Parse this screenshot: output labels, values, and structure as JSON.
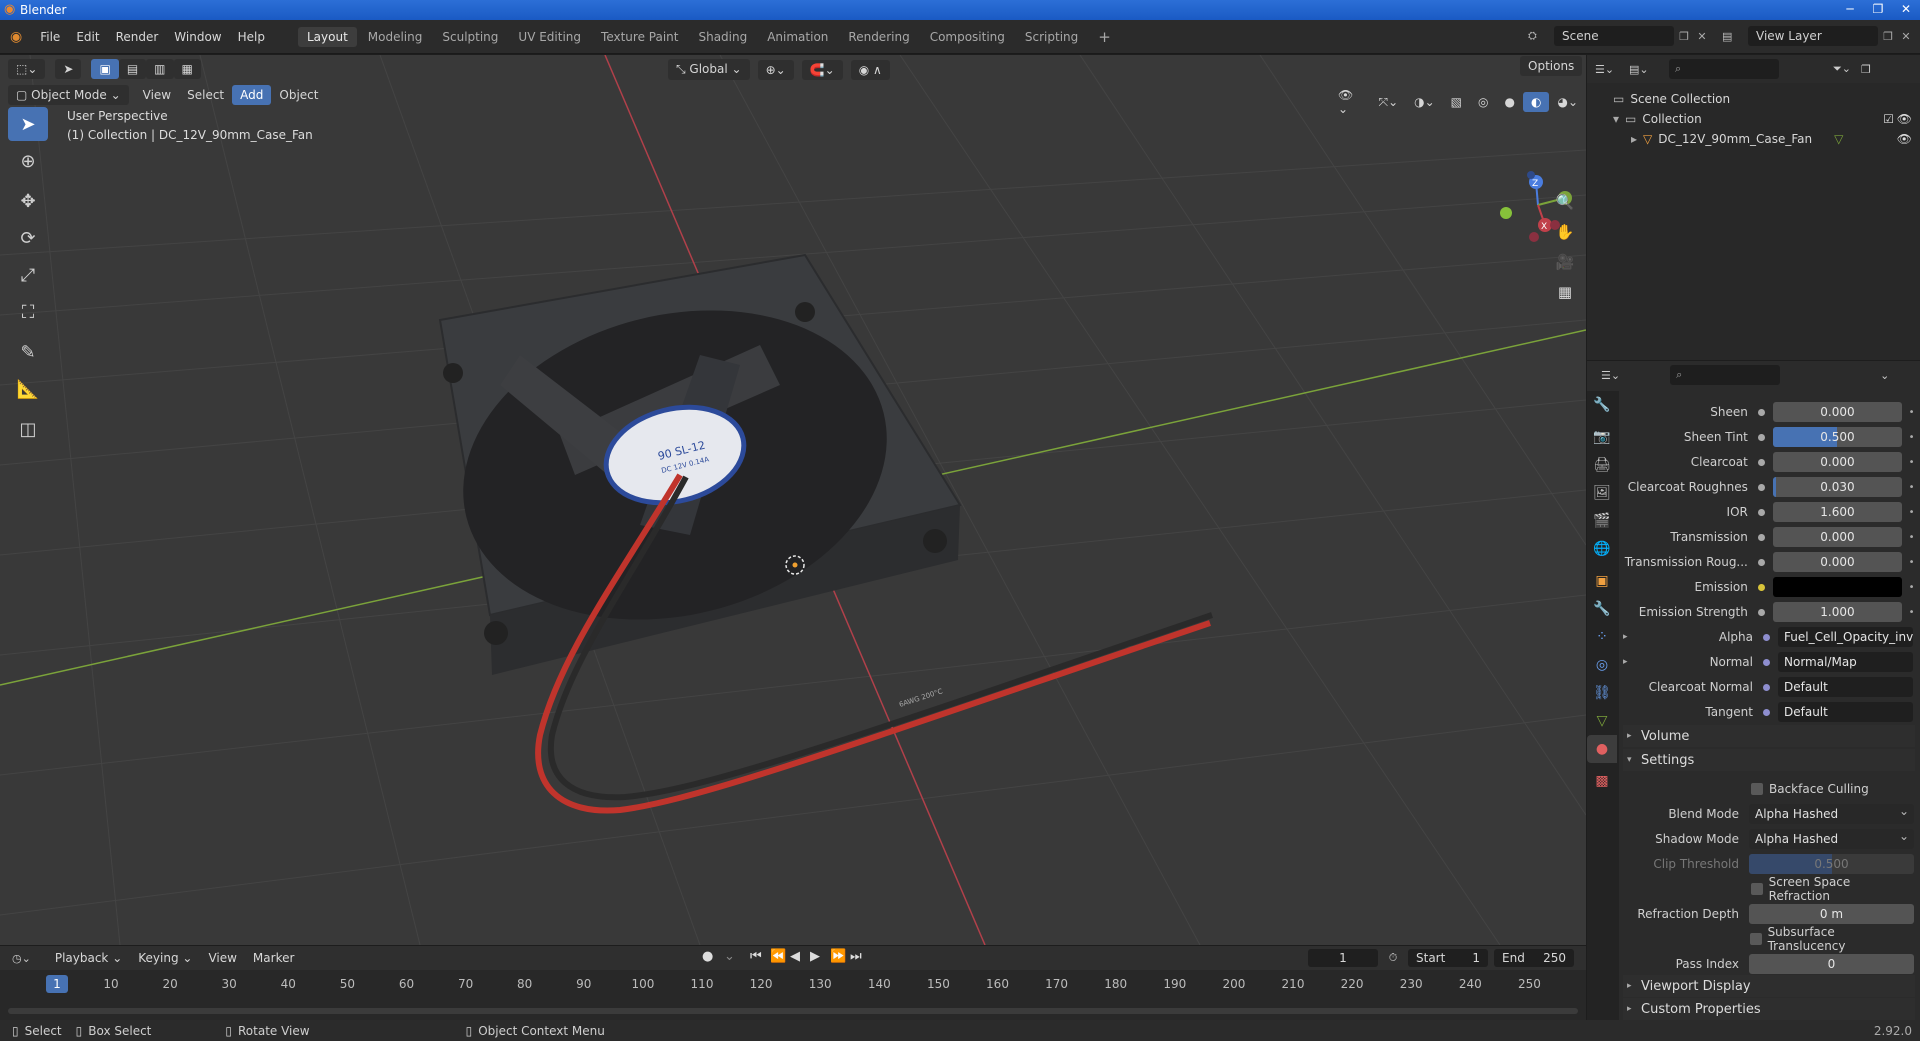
{
  "app": {
    "title": "Blender",
    "version": "2.92.0"
  },
  "menu": {
    "items": [
      "File",
      "Edit",
      "Render",
      "Window",
      "Help"
    ]
  },
  "workspaces": [
    "Layout",
    "Modeling",
    "Sculpting",
    "UV Editing",
    "Texture Paint",
    "Shading",
    "Animation",
    "Rendering",
    "Compositing",
    "Scripting"
  ],
  "workspace_add": "+",
  "scene": {
    "name": "Scene",
    "view_layer": "View Layer"
  },
  "viewport": {
    "mode": "Object Mode",
    "menus": [
      "View",
      "Select",
      "Add",
      "Object"
    ],
    "active_menu": "Add",
    "orientation": "Global",
    "options_label": "Options",
    "info_line1": "User Perspective",
    "info_line2": "(1) Collection | DC_12V_90mm_Case_Fan",
    "fan_label": "90 SL-12",
    "fan_sublabel": "DC 12V 0.14A",
    "cable_print": "6AWG 200°C",
    "axis_labels": {
      "x": "X",
      "y": "Y",
      "z": "Z"
    }
  },
  "outliner": {
    "root": "Scene Collection",
    "collection": "Collection",
    "object": "DC_12V_90mm_Case_Fan"
  },
  "properties": {
    "rows": [
      {
        "label": "Sheen",
        "value": "0.000",
        "fill": 0
      },
      {
        "label": "Sheen Tint",
        "value": "0.500",
        "fill": 0.5
      },
      {
        "label": "Clearcoat",
        "value": "0.000",
        "fill": 0
      },
      {
        "label": "Clearcoat Roughnes",
        "value": "0.030",
        "fill": 0.03
      },
      {
        "label": "IOR",
        "value": "1.600",
        "fill": 0
      },
      {
        "label": "Transmission",
        "value": "0.000",
        "fill": 0
      },
      {
        "label": "Transmission Roug...",
        "value": "0.000",
        "fill": 0
      },
      {
        "label": "Emission",
        "value": "",
        "fill": 0
      },
      {
        "label": "Emission Strength",
        "value": "1.000",
        "fill": 0
      }
    ],
    "links": [
      {
        "label": "Alpha",
        "value": "Fuel_Cell_Opacity_invert..."
      },
      {
        "label": "Normal",
        "value": "Normal/Map"
      },
      {
        "label": "Clearcoat Normal",
        "value": "Default"
      },
      {
        "label": "Tangent",
        "value": "Default"
      }
    ],
    "sections": {
      "volume": "Volume",
      "settings": "Settings",
      "viewport_display": "Viewport Display",
      "custom_properties": "Custom Properties"
    },
    "settings": {
      "backface_culling": "Backface Culling",
      "blend_mode_label": "Blend Mode",
      "blend_mode": "Alpha Hashed",
      "shadow_mode_label": "Shadow Mode",
      "shadow_mode": "Alpha Hashed",
      "clip_threshold_label": "Clip Threshold",
      "clip_threshold": "0.500",
      "ssr": "Screen Space Refraction",
      "refraction_depth_label": "Refraction Depth",
      "refraction_depth": "0 m",
      "sss": "Subsurface Translucency",
      "pass_index_label": "Pass Index",
      "pass_index": "0"
    }
  },
  "timeline": {
    "menus": [
      "Playback",
      "Keying",
      "View",
      "Marker"
    ],
    "current_frame": "1",
    "start_label": "Start",
    "start": "1",
    "end_label": "End",
    "end": "250",
    "ticks": [
      "10",
      "20",
      "30",
      "40",
      "50",
      "60",
      "70",
      "80",
      "90",
      "100",
      "110",
      "120",
      "130",
      "140",
      "150",
      "160",
      "170",
      "180",
      "190",
      "200",
      "210",
      "220",
      "230",
      "240",
      "250"
    ],
    "playhead": "1"
  },
  "statusbar": {
    "select": "Select",
    "box_select": "Box Select",
    "rotate_view": "Rotate View",
    "context_menu": "Object Context Menu"
  },
  "colors": {
    "accent": "#4772b3",
    "viewport_bg": "#393939",
    "x_axis": "#b0404a",
    "y_axis": "#7ba33a"
  }
}
